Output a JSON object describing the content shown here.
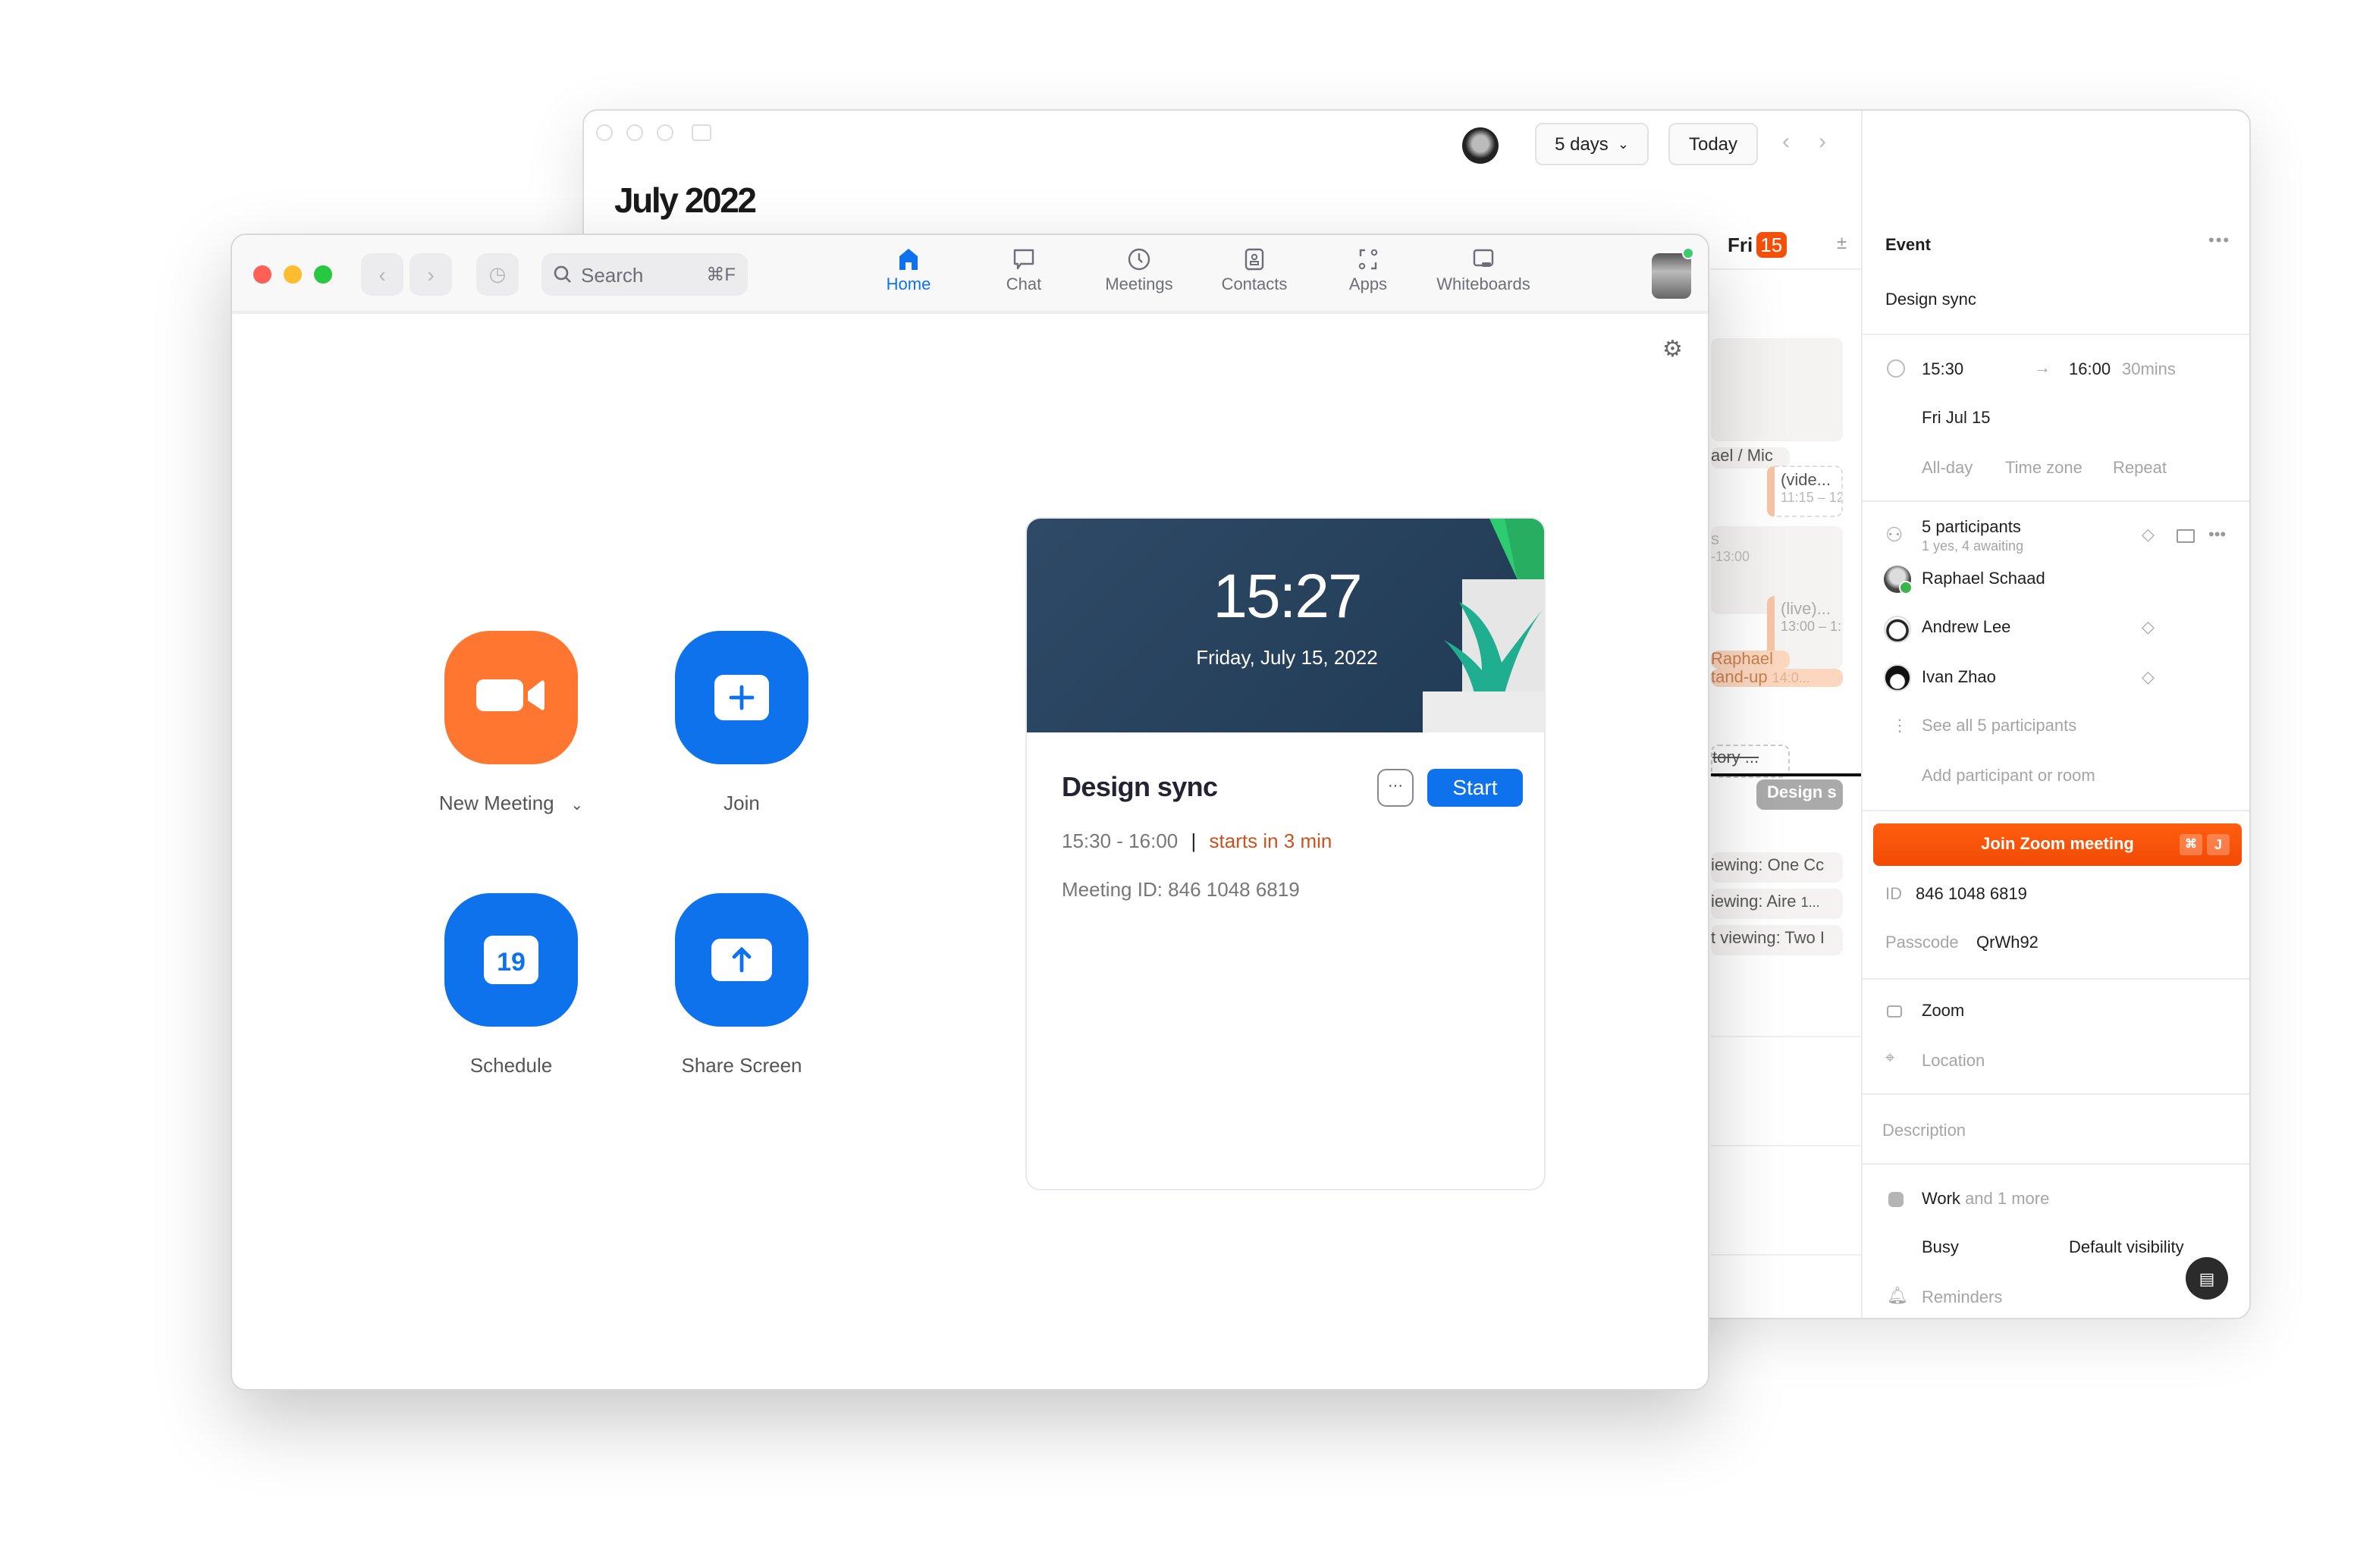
{
  "calendar": {
    "title": "July 2022",
    "view_select": "5 days",
    "today_label": "Today",
    "day_label": "Fri",
    "day_number": "15",
    "events": [
      {
        "text": "ael / Mic"
      },
      {
        "title": "(vide...",
        "time": "11:15 – 12"
      },
      {
        "title": "s",
        "time": "-13:00"
      },
      {
        "title": "(live)...",
        "time": "13:00 – 1:"
      },
      {
        "text": "Raphael"
      },
      {
        "title": "tand-up",
        "time": "14:0..."
      },
      {
        "text": "tory ..."
      },
      {
        "text": "Design s"
      },
      {
        "text": "iewing: One Cc"
      },
      {
        "text": "iewing: Aire",
        "extra": "1..."
      },
      {
        "text": "t viewing: Two I"
      }
    ],
    "panel": {
      "header": "Event",
      "event_title": "Design sync",
      "start": "15:30",
      "end": "16:00",
      "duration": "30mins",
      "date": "Fri Jul 15",
      "options": [
        "All-day",
        "Time zone",
        "Repeat"
      ],
      "participants_count": "5 participants",
      "participants_status": "1 yes, 4 awaiting",
      "participants": [
        {
          "name": "Raphael Schaad",
          "accepted": true
        },
        {
          "name": "Andrew Lee",
          "accepted": false
        },
        {
          "name": "Ivan Zhao",
          "accepted": false
        }
      ],
      "see_all": "See all 5 participants",
      "add_participant": "Add participant or room",
      "join_button": "Join Zoom meeting",
      "join_shortcut": [
        "⌘",
        "J"
      ],
      "id_label": "ID",
      "id_value": "846 1048 6819",
      "passcode_label": "Passcode",
      "passcode_value": "QrWh92",
      "conferencing": "Zoom",
      "location_placeholder": "Location",
      "description_placeholder": "Description",
      "calendar_name": "Work",
      "calendar_more": "and 1 more",
      "availability": "Busy",
      "visibility": "Default visibility",
      "reminders": "Reminders"
    },
    "accent": "#f5500a"
  },
  "zoom": {
    "search_placeholder": "Search",
    "search_shortcut": "⌘F",
    "nav": [
      "Home",
      "Chat",
      "Meetings",
      "Contacts",
      "Apps",
      "Whiteboards"
    ],
    "active_nav": "Home",
    "actions": [
      "New Meeting",
      "Join",
      "Schedule",
      "Share Screen"
    ],
    "schedule_icon_day": "19",
    "card": {
      "clock": "15:27",
      "date": "Friday, July 15, 2022",
      "title": "Design sync",
      "more": "···",
      "start_button": "Start",
      "time_range": "15:30 - 16:00",
      "divider": "|",
      "starts_in": "starts in 3 min",
      "meeting_id": "Meeting ID: 846 1048 6819"
    },
    "colors": {
      "blue": "#0e72ed",
      "orange": "#ff7630",
      "status": "#3fcb6b"
    }
  }
}
